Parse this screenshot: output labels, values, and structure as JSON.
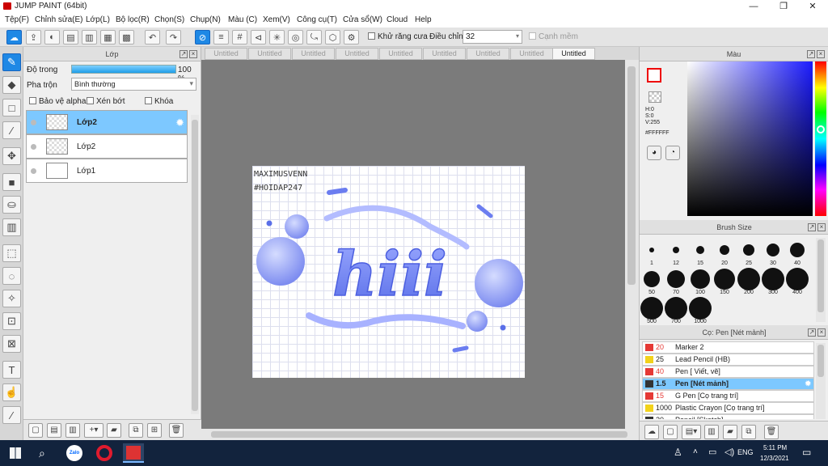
{
  "window": {
    "title": "JUMP PAINT (64bit)",
    "minimize": "—",
    "maximize": "❐",
    "close": "✕"
  },
  "menu": [
    "Tệp(F)",
    "Chỉnh sửa(E)",
    "Lớp(L)",
    "Bộ lọc(R)",
    "Chọn(S)",
    "Chụp(N)",
    "Màu (C)",
    "Xem(V)",
    "Công cụ(T)",
    "Cửa sổ(W)",
    "Cloud",
    "Help"
  ],
  "toolbar": {
    "antialias_label": "Khử răng cưa",
    "adjust_label": "Điều chỉnh",
    "adjust_value": "32",
    "smooth_label": "Cạnh mềm"
  },
  "layer_panel": {
    "title": "Lớp",
    "opacity_label": "Độ trong",
    "opacity_value": "100 %",
    "opacity_fraction": 1.0,
    "blend_label": "Pha trộn",
    "blend_value": "Bình thường",
    "protect_alpha": "Bảo vệ alpha",
    "clip": "Xén bớt",
    "lock": "Khóa",
    "layers": [
      "Lớp2",
      "Lớp2",
      "Lớp1"
    ]
  },
  "tabs": [
    "Untitled",
    "Untitled",
    "Untitled",
    "Untitled",
    "Untitled",
    "Untitled",
    "Untitled",
    "Untitled",
    "Untitled"
  ],
  "artwork": {
    "text1": "MAXIMUSVENN",
    "text2": "#HOIDAP247",
    "lettering": "hiii"
  },
  "color_panel": {
    "title": "Màu",
    "h": "H:0",
    "s": "S:0",
    "v": "V:255",
    "hex": "#FFFFFF"
  },
  "brush_size": {
    "title": "Brush Size",
    "sizes": [
      "1",
      "12",
      "15",
      "20",
      "25",
      "30",
      "40",
      "50",
      "70",
      "100",
      "150",
      "200",
      "300",
      "400",
      "500",
      "700",
      "1000"
    ]
  },
  "pen_panel": {
    "title": "Cọ: Pen [Nét mảnh]",
    "items": [
      {
        "size": "20",
        "name": "Marker 2",
        "color": "#e53935"
      },
      {
        "size": "25",
        "name": "Lead Pencil (HB)",
        "color": "#f2d21b"
      },
      {
        "size": "40",
        "name": "Pen [ Viết, vẽ]",
        "color": "#e53935"
      },
      {
        "size": "1.5",
        "name": "Pen [Nét mảnh]",
        "color": "#333333"
      },
      {
        "size": "15",
        "name": "G Pen [Cọ trang trí]",
        "color": "#e53935"
      },
      {
        "size": "1000",
        "name": "Plastic Crayon [Cọ trang trí]",
        "color": "#f2d21b"
      },
      {
        "size": "20",
        "name": "Pencil [Sketch]",
        "color": "#333333"
      }
    ]
  },
  "taskbar": {
    "lang": "ENG",
    "time": "5:11 PM",
    "date": "12/3/2021"
  }
}
